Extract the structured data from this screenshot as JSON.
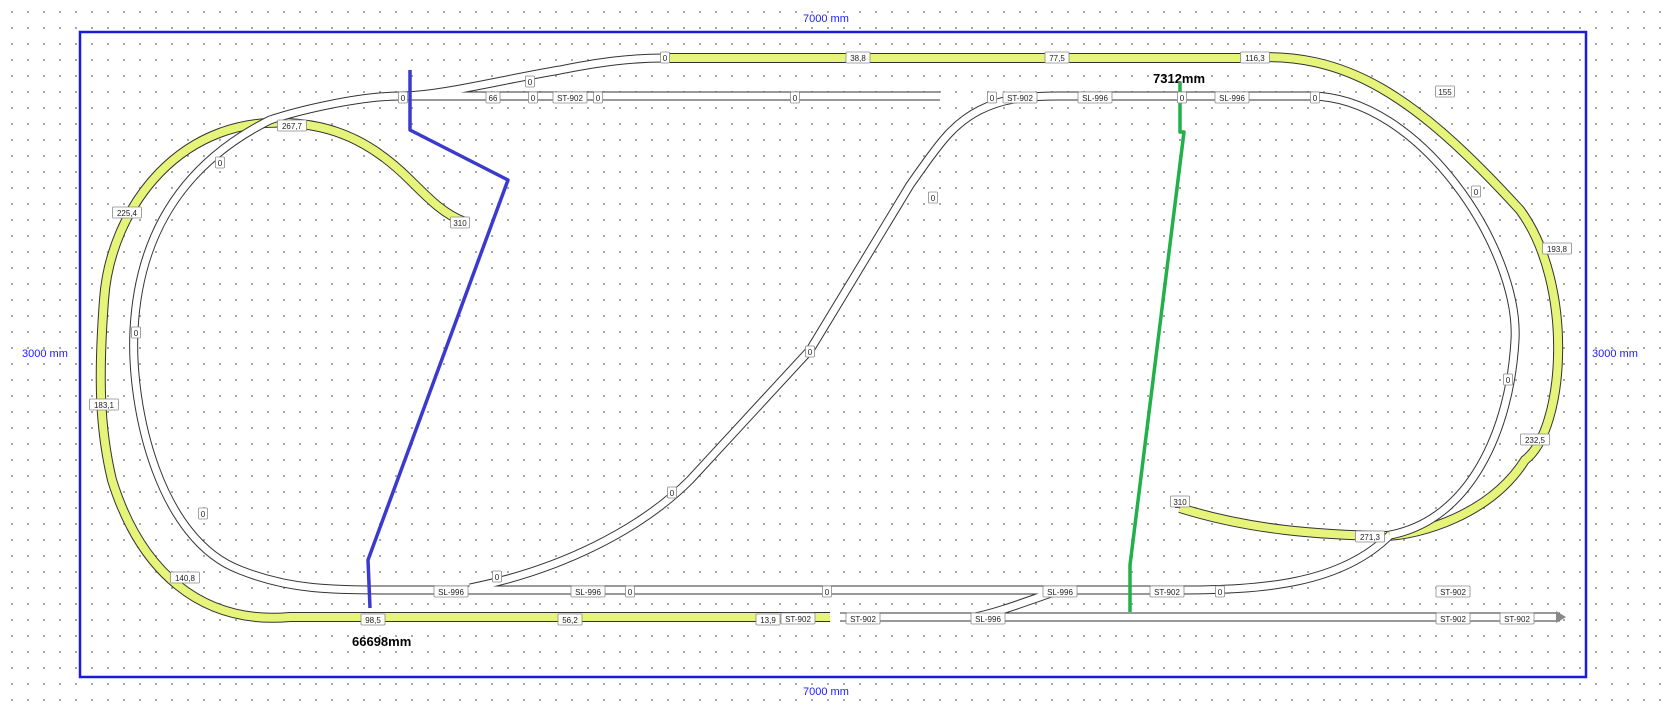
{
  "dimensions": {
    "top": "7000 mm",
    "bottom": "7000 mm",
    "left": "3000 mm",
    "right": "3000 mm"
  },
  "measurements": {
    "top_right": "7312mm",
    "bottom_left": "66698mm"
  },
  "colors": {
    "frame": "#1b1bdc",
    "raised_track": "#e6f47a",
    "measure_blue": "#3a3ad0",
    "measure_green": "#22b04a"
  },
  "labels": {
    "outer_top": [
      "0",
      "38,8",
      "77,5",
      "116,3"
    ],
    "outer_right": [
      "155",
      "193,8",
      "232,5",
      "271,3"
    ],
    "outer_left": [
      "267,7",
      "225,4",
      "183,1",
      "140,8"
    ],
    "outer_bottom": [
      "98,5",
      "56,2",
      "13,9"
    ],
    "spur": [
      "310",
      "310"
    ],
    "inner": [
      "0",
      "0",
      "0",
      "0",
      "0",
      "0",
      "0",
      "0",
      "0",
      "0",
      "0",
      "0",
      "0",
      "0",
      "0",
      "0",
      "0",
      "0",
      "0",
      "0"
    ],
    "parts": [
      "ST-902",
      "ST-902",
      "SL-996",
      "SL-996",
      "SL-996",
      "SL-996",
      "SL-996",
      "SL-996",
      "ST-902",
      "ST-902",
      "ST-902",
      "ST-902",
      "ST-902",
      "ST-902",
      "66"
    ]
  }
}
